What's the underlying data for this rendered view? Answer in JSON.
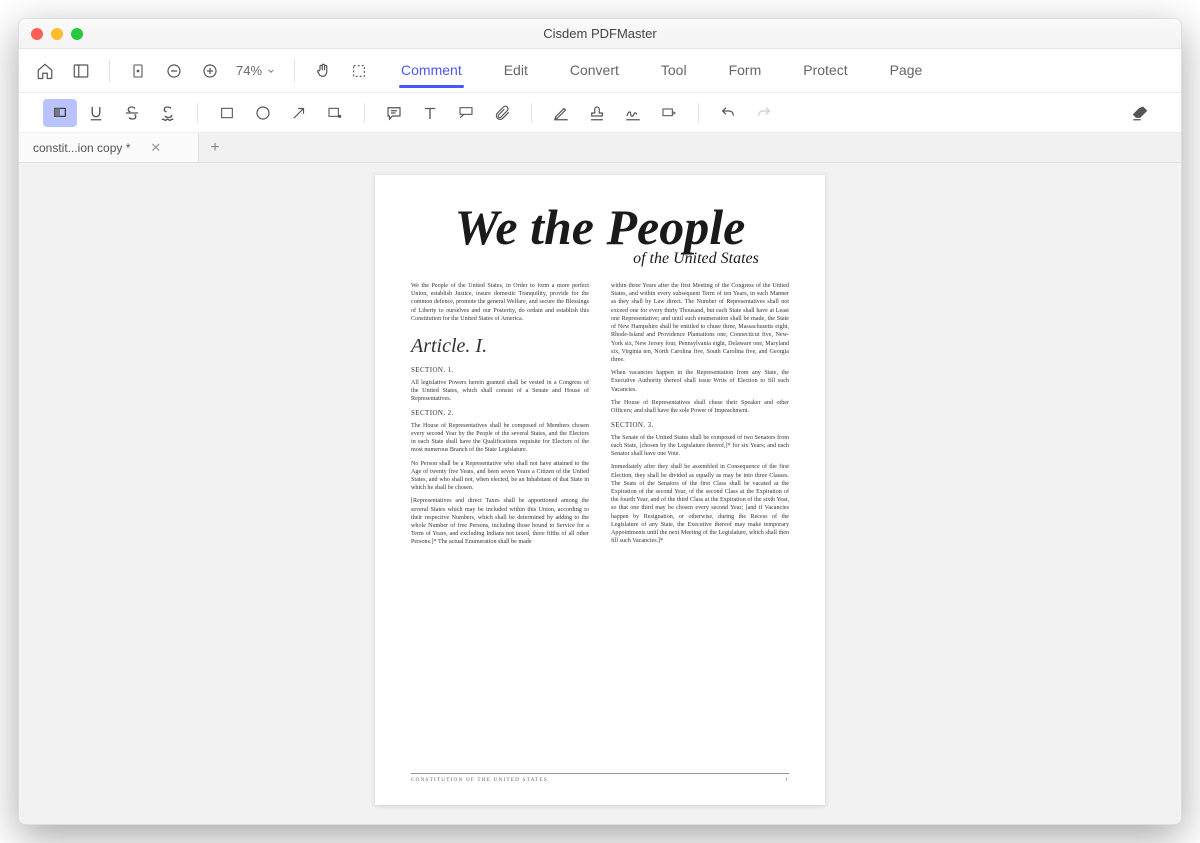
{
  "app_title": "Cisdem PDFMaster",
  "toolbar1": {
    "zoom_label": "74%",
    "menu": [
      "Comment",
      "Edit",
      "Convert",
      "Tool",
      "Form",
      "Protect",
      "Page"
    ],
    "active_menu": "Comment"
  },
  "doc_tab": {
    "name": "constit...ion copy *"
  },
  "document": {
    "title_main": "We the People",
    "title_sub": "of the United States",
    "preamble": "We the People of the United States, in Order to form a more perfect Union, establish Justice, insure domestic Tranquility, provide for the common defence, promote the general Welfare, and secure the Blessings of Liberty to ourselves and our Posterity, do ordain and establish this Constitution for the United States of America.",
    "article_heading": "Article. I.",
    "sec1_h": "SECTION. 1.",
    "sec1_p": "All legislative Powers herein granted shall be vested in a Congress of the United States, which shall consist of a Senate and House of Representatives.",
    "sec2_h": "SECTION. 2.",
    "sec2_p1": "The House of Representatives shall be composed of Members chosen every second Year by the People of the several States, and the Electors in each State shall have the Qualifications requisite for Electors of the most numerous Branch of the State Legislature.",
    "sec2_p2": "No Person shall be a Representative who shall not have attained to the Age of twenty five Years, and been seven Years a Citizen of the United States, and who shall not, when elected, be an Inhabitant of that State in which he shall be chosen.",
    "sec2_p3": "[Representatives and direct Taxes shall be apportioned among the several States which may be included within this Union, according to their respective Numbers, which shall be determined by adding to the whole Number of free Persons, including those bound to Service for a Term of Years, and excluding Indians not taxed, three fifths of all other Persons.]* The actual Enumeration shall be made",
    "col2_p1": "within three Years after the first Meeting of the Congress of the United States, and within every subsequent Term of ten Years, in such Manner as they shall by Law direct. The Number of Representatives shall not exceed one for every thirty Thousand, but each State shall have at Least one Representative; and until such enumeration shall be made, the State of New Hampshire shall be entitled to chuse three, Massachusetts eight, Rhode-Island and Providence Plantations one, Connecticut five, New-York six, New Jersey four, Pennsylvania eight, Delaware one, Maryland six, Virginia ten, North Carolina five, South Carolina five, and Georgia three.",
    "col2_p2": "When vacancies happen in the Representation from any State, the Executive Authority thereof shall issue Writs of Election to fill such Vacancies.",
    "col2_p3": "The House of Representatives shall chuse their Speaker and other Officers; and shall have the sole Power of Impeachment.",
    "sec3_h": "SECTION. 3.",
    "sec3_p1": "The Senate of the United States shall be composed of two Senators from each State, [chosen by the Legislature thereof,]* for six Years; and each Senator shall have one Vote.",
    "sec3_p2": "Immediately after they shall be assembled in Consequence of the first Election, they shall be divided as equally as may be into three Classes. The Seats of the Senators of the first Class shall be vacated at the Expiration of the second Year, of the second Class at the Expiration of the fourth Year, and of the third Class at the Expiration of the sixth Year, so that one third may be chosen every second Year; [and if Vacancies happen by Resignation, or otherwise, during the Recess of the Legislature of any State, the Executive thereof may make temporary Appointments until the next Meeting of the Legislature, which shall then fill such Vacancies.]*",
    "footer_left": "CONSTITUTION OF THE UNITED STATES",
    "footer_right": "1"
  }
}
